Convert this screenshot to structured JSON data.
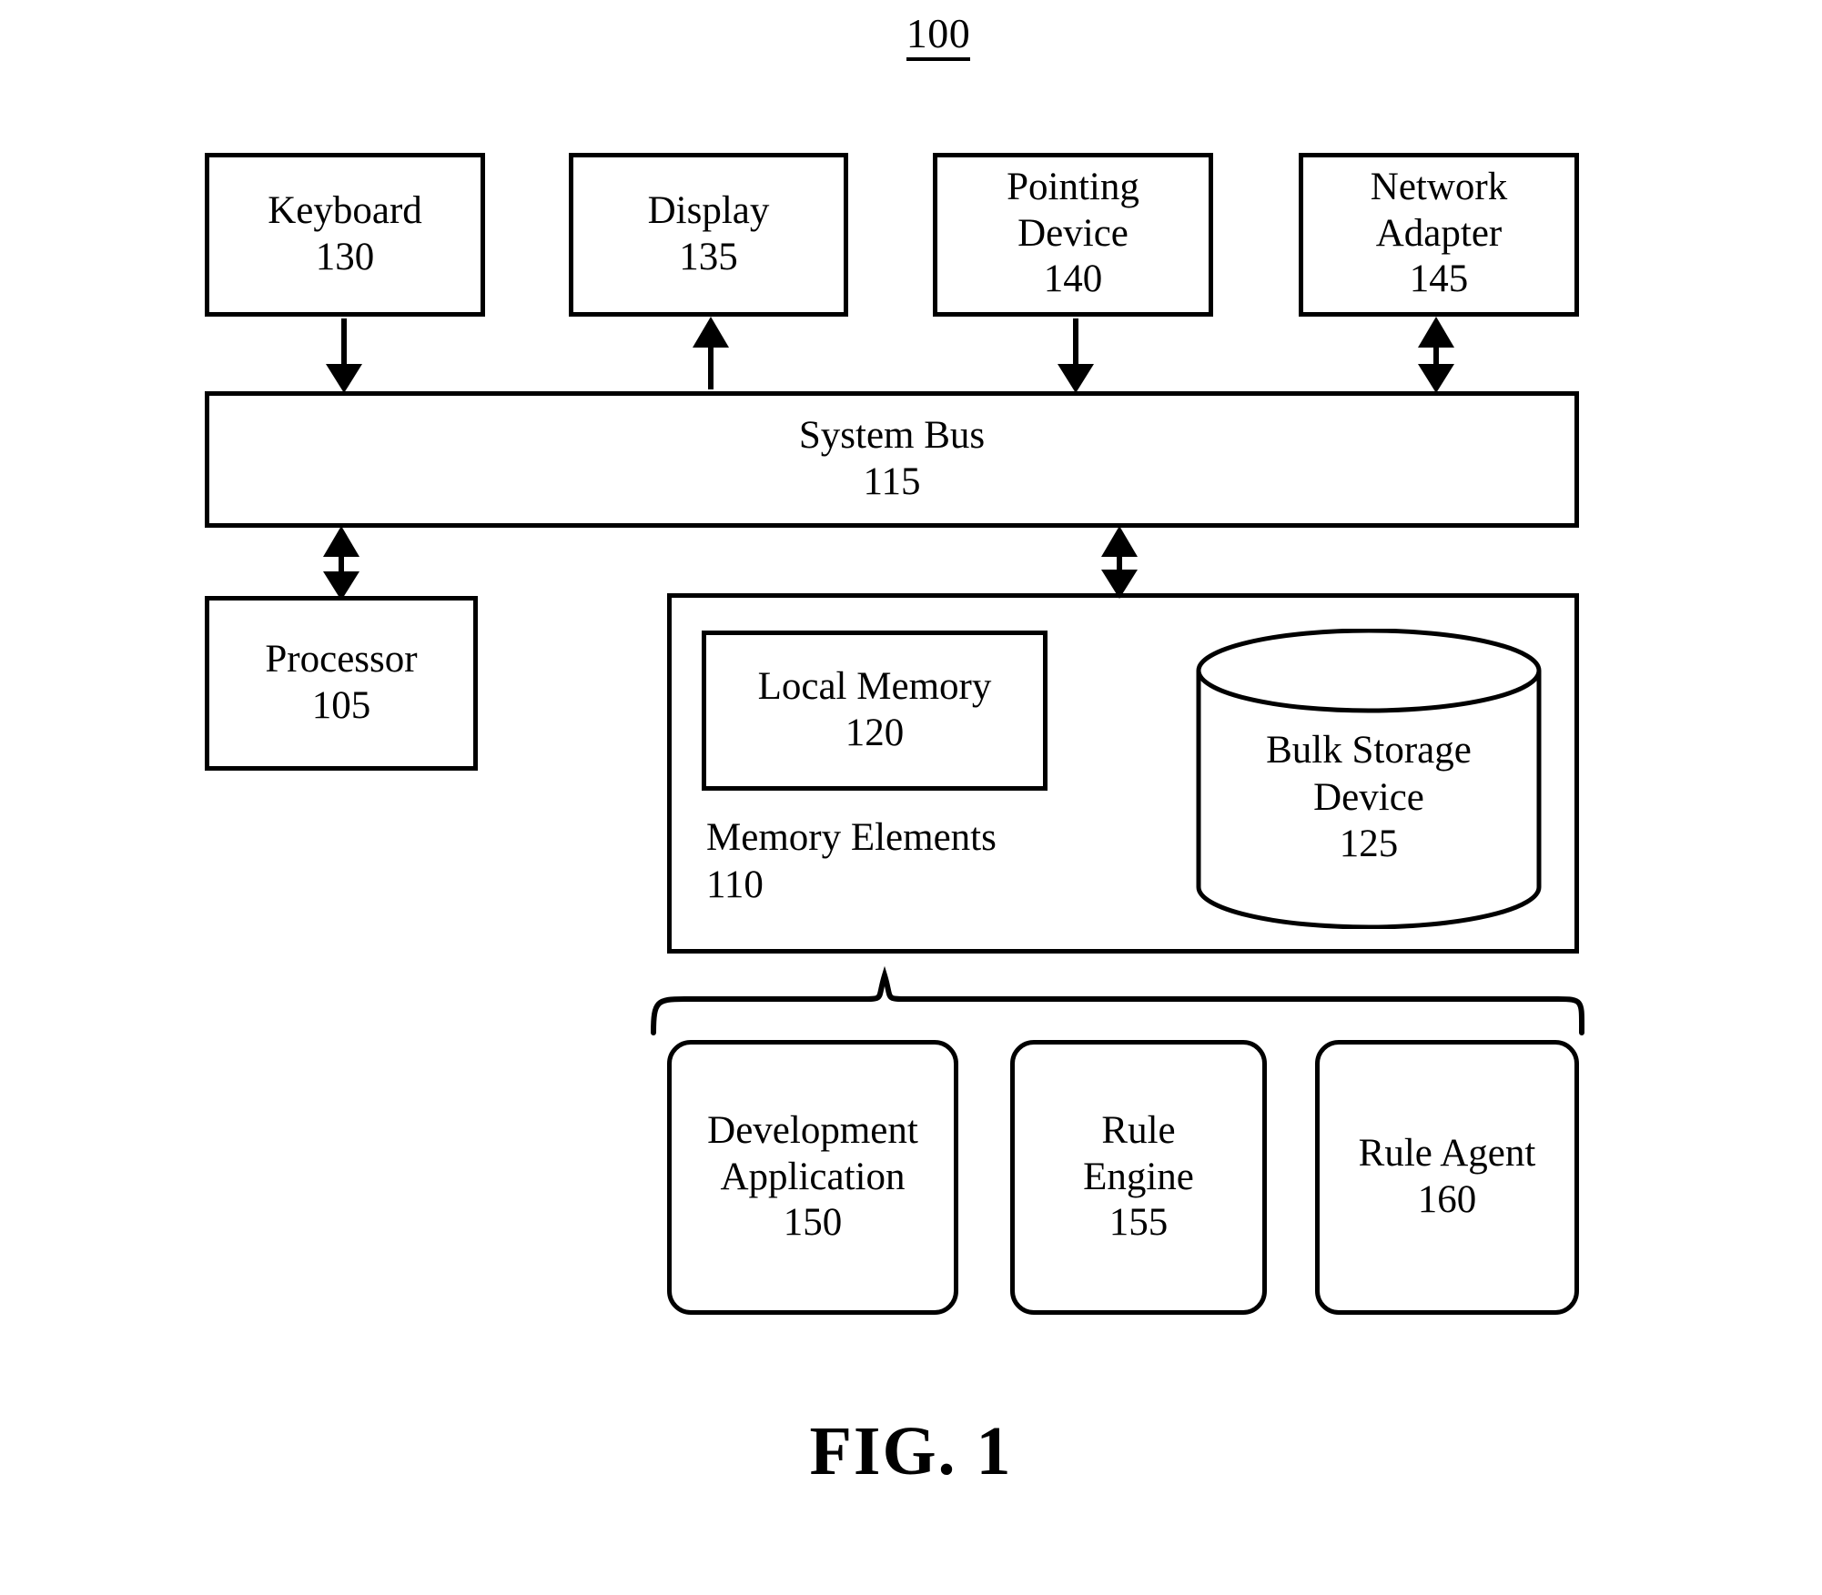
{
  "figure": {
    "reference_number": "100",
    "caption": "FIG. 1"
  },
  "blocks": {
    "keyboard": {
      "title": "Keyboard",
      "ref": "130"
    },
    "display": {
      "title": "Display",
      "ref": "135"
    },
    "pointing_device": {
      "title_line1": "Pointing",
      "title_line2": "Device",
      "ref": "140"
    },
    "network_adapter": {
      "title_line1": "Network",
      "title_line2": "Adapter",
      "ref": "145"
    },
    "system_bus": {
      "title": "System Bus",
      "ref": "115"
    },
    "processor": {
      "title": "Processor",
      "ref": "105"
    },
    "memory_elements": {
      "title": "Memory Elements",
      "ref": "110"
    },
    "local_memory": {
      "title": "Local Memory",
      "ref": "120"
    },
    "bulk_storage": {
      "title_line1": "Bulk Storage",
      "title_line2": "Device",
      "ref": "125"
    },
    "development_application": {
      "title_line1": "Development",
      "title_line2": "Application",
      "ref": "150"
    },
    "rule_engine": {
      "title_line1": "Rule",
      "title_line2": "Engine",
      "ref": "155"
    },
    "rule_agent": {
      "title": "Rule Agent",
      "ref": "160"
    }
  },
  "connectors": [
    {
      "name": "keyboard-to-bus",
      "direction": "down"
    },
    {
      "name": "display-from-bus",
      "direction": "up"
    },
    {
      "name": "pointing-device-to-bus",
      "direction": "down"
    },
    {
      "name": "network-adapter-bus",
      "direction": "both"
    },
    {
      "name": "bus-to-processor",
      "direction": "both"
    },
    {
      "name": "bus-to-memory-elements",
      "direction": "both"
    }
  ],
  "style": {
    "stroke": "#000000",
    "background": "#ffffff"
  }
}
